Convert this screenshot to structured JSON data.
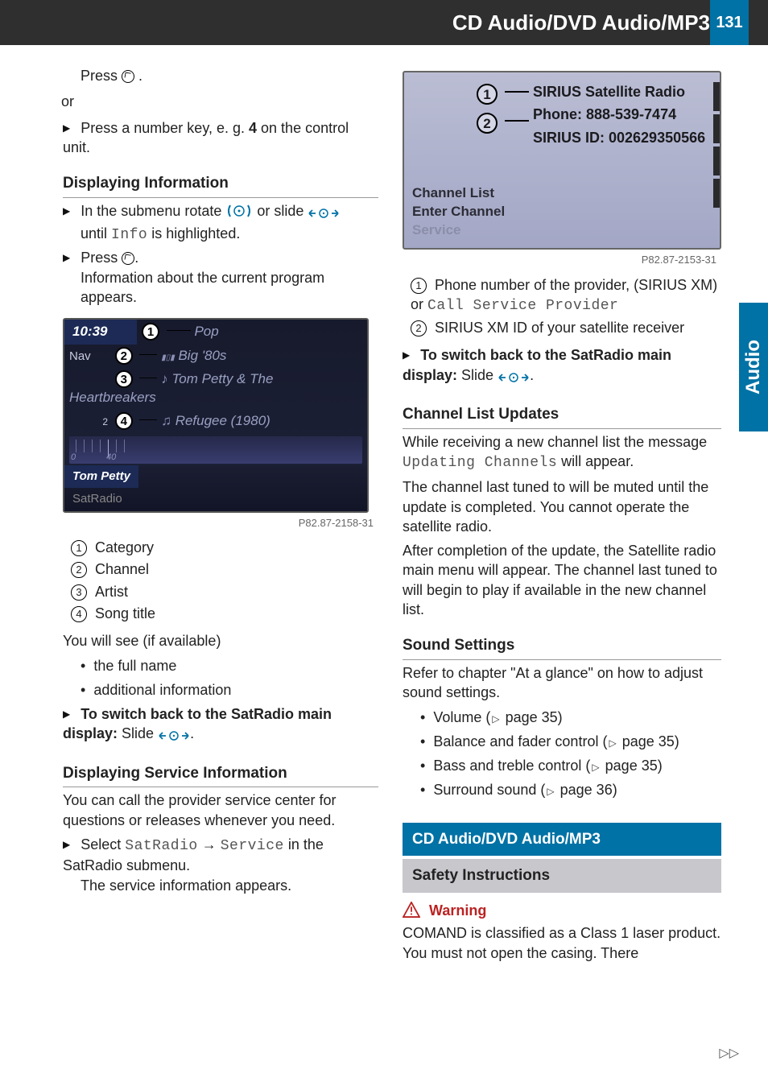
{
  "header": {
    "title": "CD Audio/DVD Audio/MP3",
    "page_number": "131"
  },
  "side_tab": "Audio",
  "left": {
    "step_press": {
      "pre": "Press ",
      "post": "."
    },
    "or": "or",
    "step_number_key": {
      "pre": "Press a number key, e. g. ",
      "bold": "4",
      "post": " on the control unit."
    },
    "sec_display_info": "Displaying Information",
    "step_rotate": {
      "pre": "In the submenu rotate ",
      "mid": " or slide ",
      "until": "until ",
      "info": "Info",
      "post": " is highlighted."
    },
    "step_press2": {
      "pre": "Press ",
      "post": "."
    },
    "info_appears": "Information about the current program appears.",
    "shot1": {
      "time": "10:39",
      "callout1_label": "Pop",
      "nav": "Nav",
      "callout2_label": "Big '80s",
      "callout3_label": "Tom Petty & The Heartbreakers",
      "callout4_label": "Refugee (1980)",
      "tick0": "0",
      "tick40": "40",
      "tab_sel": "Tom Petty",
      "tab_other": "SatRadio",
      "ref": "P82.87-2158-31"
    },
    "callouts": {
      "c1": "Category",
      "c2": "Channel",
      "c3": "Artist",
      "c4": "Song title"
    },
    "youwillsee": "You will see (if available)",
    "b_fullname": "the full name",
    "b_addinfo": "additional information",
    "switch_back": {
      "bold": "To switch back to the SatRadio main display:",
      "slide": " Slide ",
      "post": "."
    },
    "sec_service_info": "Displaying Service Information",
    "service_text": "You can call the provider service center for questions or releases whenever you need.",
    "step_select": {
      "pre": "Select ",
      "m1": "SatRadio",
      "arrow": " → ",
      "m2": "Service",
      "post": " in the SatRadio submenu."
    },
    "service_appears": "The service information appears."
  },
  "right": {
    "shot2": {
      "line1": "SIRIUS Satellite Radio",
      "line2": "Phone: 888-539-7474",
      "line3": "SIRIUS ID: 002629350566",
      "left1": "Channel List",
      "left2": "Enter Channel",
      "left3": "Service",
      "ref": "P82.87-2153-31"
    },
    "callout1": {
      "pre": "Phone number of the provider, (SIRIUS XM) or ",
      "mono": "Call Service Provider"
    },
    "callout2": "SIRIUS XM ID of your satellite receiver",
    "switch_back": {
      "bold": "To switch back to the SatRadio main display:",
      "slide": " Slide ",
      "post": "."
    },
    "sec_updates": "Channel List Updates",
    "upd1": {
      "pre": "While receiving a new channel list the message ",
      "mono": "Updating Channels",
      "post": " will appear."
    },
    "upd2": "The channel last tuned to will be muted until the update is completed. You cannot operate the satellite radio.",
    "upd3": "After completion of the update, the Satellite radio main menu will appear. The channel last tuned to will begin to play if available in the new channel list.",
    "sec_sound": "Sound Settings",
    "sound_intro": "Refer to chapter \"At a glance\" on how to adjust sound settings.",
    "s1": {
      "t": "Volume (",
      "p": " page 35)"
    },
    "s2": {
      "t": "Balance and fader control (",
      "p": " page 35)"
    },
    "s3": {
      "t": "Bass and treble control (",
      "p": " page 35)"
    },
    "s4": {
      "t": "Surround sound (",
      "p": " page 36)"
    },
    "bluebar": "CD Audio/DVD Audio/MP3",
    "greybar": "Safety Instructions",
    "warning": "Warning",
    "warn_text": "COMAND is classified as a Class 1 laser product. You must not open the casing. There"
  },
  "cont_marker": "▷▷"
}
